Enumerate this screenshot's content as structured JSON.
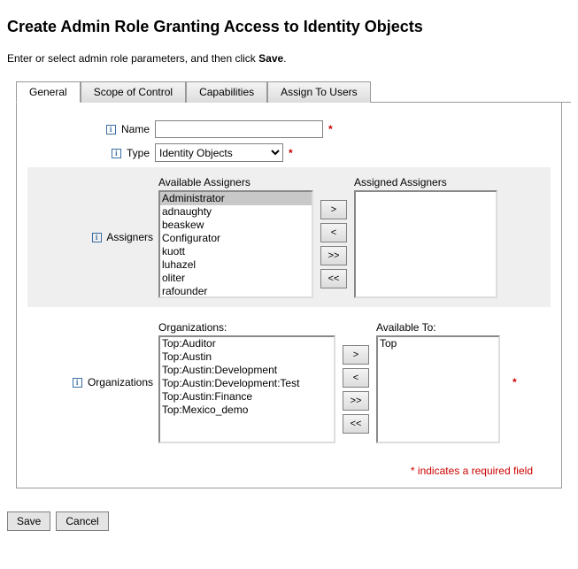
{
  "page": {
    "title": "Create Admin Role Granting Access to Identity Objects",
    "intro_prefix": "Enter or select admin role parameters, and then click ",
    "intro_bold": "Save",
    "intro_suffix": ".",
    "required_note": "* indicates a required field"
  },
  "tabs": {
    "general": "General",
    "scope": "Scope of Control",
    "capabilities": "Capabilities",
    "assign": "Assign To Users"
  },
  "fields": {
    "name_label": "Name",
    "name_value": "",
    "type_label": "Type",
    "type_value": "Identity Objects",
    "assigners_label": "Assigners",
    "organizations_label": "Organizations"
  },
  "assigners": {
    "available_title": "Available Assigners",
    "assigned_title": "Assigned Assigners",
    "available": [
      "Administrator",
      "adnaughty",
      "beaskew",
      "Configurator",
      "kuott",
      "luhazel",
      "oliter",
      "rafounder"
    ],
    "assigned": []
  },
  "orgs": {
    "available_title": "Organizations:",
    "assigned_title": "Available To:",
    "available": [
      "Top:Auditor",
      "Top:Austin",
      "Top:Austin:Development",
      "Top:Austin:Development:Test",
      "Top:Austin:Finance",
      "Top:Mexico_demo"
    ],
    "assigned": [
      "Top"
    ]
  },
  "buttons": {
    "add": ">",
    "remove": "<",
    "add_all": ">>",
    "remove_all": "<<",
    "save": "Save",
    "cancel": "Cancel"
  }
}
